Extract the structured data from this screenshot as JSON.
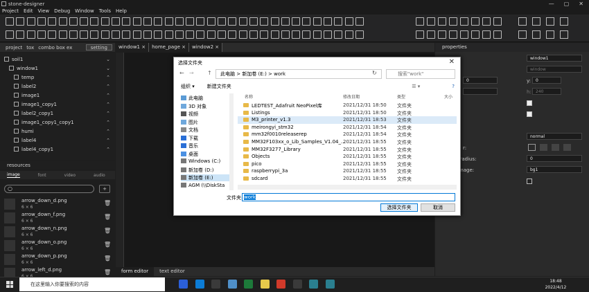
{
  "window_title": "stone-designer",
  "menu": [
    "Project",
    "Edit",
    "View",
    "Debug",
    "Window",
    "Tools",
    "Help"
  ],
  "left_tabs": {
    "project": "project",
    "tox": "tox",
    "combo": "combo box ex",
    "setting": "setting"
  },
  "tree": [
    {
      "label": "soil1",
      "indent": 0,
      "arrow": "⌄"
    },
    {
      "label": "window1",
      "indent": 1,
      "arrow": "⌄"
    },
    {
      "label": "temp",
      "indent": 2,
      "arrow": "⌃"
    },
    {
      "label": "label2",
      "indent": 2,
      "arrow": "⌃"
    },
    {
      "label": "image1",
      "indent": 2,
      "arrow": "⌃"
    },
    {
      "label": "image1_copy1",
      "indent": 2,
      "arrow": "⌃"
    },
    {
      "label": "label2_copy1",
      "indent": 2,
      "arrow": "⌃"
    },
    {
      "label": "image1_copy1_copy1",
      "indent": 2,
      "arrow": "⌃"
    },
    {
      "label": "humi",
      "indent": 2,
      "arrow": "⌃"
    },
    {
      "label": "label4",
      "indent": 2,
      "arrow": "⌃"
    },
    {
      "label": "label4_copy1",
      "indent": 2,
      "arrow": "⌃"
    }
  ],
  "resources_header": "resources",
  "resource_tabs": [
    "image",
    "font",
    "video",
    "audio"
  ],
  "resources": [
    {
      "name": "arrow_down_d.png",
      "size": "6 × 6"
    },
    {
      "name": "arrow_down_f.png",
      "size": "6 × 6"
    },
    {
      "name": "arrow_down_n.png",
      "size": "6 × 6"
    },
    {
      "name": "arrow_down_o.png",
      "size": "6 × 6"
    },
    {
      "name": "arrow_down_p.png",
      "size": "6 × 6"
    },
    {
      "name": "arrow_left_d.png",
      "size": "6 × 6"
    }
  ],
  "doc_tabs": [
    "window1 ×",
    "home_page ×",
    "window2 ×"
  ],
  "editor_tabs": [
    "form editor",
    "text editor"
  ],
  "properties": {
    "header": "properties",
    "name": "window1",
    "name2": "window",
    "y_label": "y:",
    "y_value": "0",
    "x_value": "0",
    "h_label": "h:",
    "h_value": "240",
    "style_value": "normal",
    "radius_label": "_radius:",
    "radius_value": "0",
    "image_label": "image:",
    "image_value": "bg1",
    "other_label": "r:"
  },
  "dialog": {
    "title": "选择文件夹",
    "path": [
      "此电脑",
      "新加卷 (E:)",
      "work"
    ],
    "search_placeholder": "搜索\"work\"",
    "organize": "组织 ▾",
    "new_folder": "新建文件夹",
    "nav": [
      {
        "label": "此电脑",
        "color": "#5b9bd5"
      },
      {
        "label": "3D 对象",
        "color": "#6fa8dc"
      },
      {
        "label": "视频",
        "color": "#555"
      },
      {
        "label": "图片",
        "color": "#6fa8dc"
      },
      {
        "label": "文档",
        "color": "#888"
      },
      {
        "label": "下载",
        "color": "#2a6fd6"
      },
      {
        "label": "音乐",
        "color": "#2a6fd6"
      },
      {
        "label": "桌面",
        "color": "#4a90e2"
      },
      {
        "label": "Windows (C:)",
        "color": "#777"
      },
      {
        "label": "新加卷 (D:)",
        "color": "#777"
      },
      {
        "label": "新加卷 (E:)",
        "color": "#777"
      },
      {
        "label": "AGM (\\\\DiskSta",
        "color": "#777"
      }
    ],
    "columns": {
      "name": "名称",
      "date": "修改日期",
      "type": "类型",
      "size": "大小"
    },
    "files": [
      {
        "name": "LEDTEST_Adafruit NeoPixel库",
        "date": "2021/12/31 18:50",
        "type": "文件夹"
      },
      {
        "name": "Listings",
        "date": "2021/12/31 18:50",
        "type": "文件夹"
      },
      {
        "name": "M3_printer_v1.3",
        "date": "2021/12/31 18:53",
        "type": "文件夹"
      },
      {
        "name": "meirongyi_stm32",
        "date": "2021/12/31 18:54",
        "type": "文件夹"
      },
      {
        "name": "mm32f0010releaserep",
        "date": "2021/12/31 18:54",
        "type": "文件夹"
      },
      {
        "name": "MM32F103xx_o_Lib_Samples_V1.04_...",
        "date": "2021/12/31 18:55",
        "type": "文件夹"
      },
      {
        "name": "MM32F3277_Library",
        "date": "2021/12/31 18:55",
        "type": "文件夹"
      },
      {
        "name": "Objects",
        "date": "2021/12/31 18:55",
        "type": "文件夹"
      },
      {
        "name": "pico",
        "date": "2021/12/31 18:55",
        "type": "文件夹"
      },
      {
        "name": "raspberrypi_3a",
        "date": "2021/12/31 18:55",
        "type": "文件夹"
      },
      {
        "name": "sdcard",
        "date": "2021/12/31 18:55",
        "type": "文件夹"
      }
    ],
    "filename_label": "文件夹:",
    "filename_value": "work",
    "ok": "选择文件夹",
    "cancel": "取消"
  },
  "taskbar": {
    "search": "在这里输入你要搜索的内容",
    "time": "18:48",
    "date": "2022/4/12"
  }
}
